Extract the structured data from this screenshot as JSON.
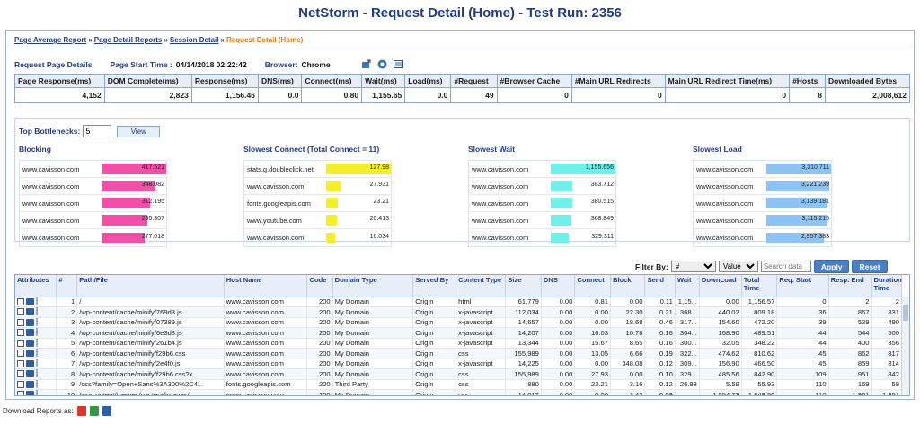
{
  "title": "NetStorm - Request Detail (Home) - Test Run: 2356",
  "breadcrumb": {
    "items": [
      "Page Average Report",
      "Page Detail Reports",
      "Session Detail"
    ],
    "current": "Request Detail (Home)",
    "separator": "»"
  },
  "info": {
    "section_label": "Request Page Details",
    "start_label": "Page Start Time :",
    "start_value": "04/14/2018 02:22:42",
    "browser_label": "Browser:",
    "browser_value": "Chrome"
  },
  "summary": {
    "headers": [
      "Page Response(ms)",
      "DOM Complete(ms)",
      "Response(ms)",
      "DNS(ms)",
      "Connect(ms)",
      "Wait(ms)",
      "Load(ms)",
      "#Request",
      "#Browser Cache",
      "#Main URL Redirects",
      "Main URL Redirect Time(ms)",
      "#Hosts",
      "Downloaded Bytes"
    ],
    "values": [
      "4,152",
      "2,823",
      "1,156.46",
      "0.0",
      "0.80",
      "1,155.65",
      "0.0",
      "49",
      "0",
      "0",
      "0",
      "8",
      "2,008,612"
    ]
  },
  "bottlenecks": {
    "label": "Top Bottlenecks:",
    "count": "5",
    "view_label": "View",
    "colors": {
      "blocking": "#f24fa8",
      "connect": "#f5ef2a",
      "wait": "#6ff0e8",
      "load": "#8ec3f5"
    },
    "blocking": {
      "title": "Blocking",
      "rows": [
        {
          "host": "www.cavisson.com",
          "value": "417.521",
          "fraction": 1.0
        },
        {
          "host": "www.cavisson.com",
          "value": "348.082",
          "fraction": 0.83
        },
        {
          "host": "www.cavisson.com",
          "value": "312.195",
          "fraction": 0.75
        },
        {
          "host": "www.cavisson.com",
          "value": "295.307",
          "fraction": 0.71
        },
        {
          "host": "www.cavisson.com",
          "value": "277.018",
          "fraction": 0.66
        }
      ]
    },
    "connect": {
      "title": "Slowest Connect (Total Connect = 11)",
      "rows": [
        {
          "host": "stats.g.doubleclick.net",
          "value": "127.98",
          "fraction": 1.0
        },
        {
          "host": "www.cavisson.com",
          "value": "27.931",
          "fraction": 0.22
        },
        {
          "host": "fonts.googleapis.com",
          "value": "23.21",
          "fraction": 0.18
        },
        {
          "host": "www.youtube.com",
          "value": "20.413",
          "fraction": 0.16
        },
        {
          "host": "www.cavisson.com",
          "value": "16.034",
          "fraction": 0.13
        }
      ]
    },
    "wait": {
      "title": "Slowest Wait",
      "rows": [
        {
          "host": "www.cavisson.com",
          "value": "1,155.656",
          "fraction": 1.0
        },
        {
          "host": "www.cavisson.com",
          "value": "383.712",
          "fraction": 0.33
        },
        {
          "host": "www.cavisson.com",
          "value": "380.515",
          "fraction": 0.33
        },
        {
          "host": "www.cavisson.com",
          "value": "368.849",
          "fraction": 0.32
        },
        {
          "host": "www.cavisson.com",
          "value": "329.311",
          "fraction": 0.28
        }
      ]
    },
    "load": {
      "title": "Slowest Load",
      "rows": [
        {
          "host": "www.cavisson.com",
          "value": "3,310.711",
          "fraction": 1.0
        },
        {
          "host": "www.cavisson.com",
          "value": "3,221.239",
          "fraction": 0.97
        },
        {
          "host": "www.cavisson.com",
          "value": "3,139.181",
          "fraction": 0.95
        },
        {
          "host": "www.cavisson.com",
          "value": "3,115.215",
          "fraction": 0.94
        },
        {
          "host": "www.cavisson.com",
          "value": "2,957.383",
          "fraction": 0.89
        }
      ]
    }
  },
  "filter": {
    "label": "Filter By:",
    "field_value": "#",
    "op_value": "Value",
    "search_placeholder": "Search data",
    "apply_label": "Apply",
    "reset_label": "Reset"
  },
  "grid": {
    "headers": [
      "Attributes",
      "#",
      "Path/File",
      "Host Name",
      "Code",
      "Domain Type",
      "Served By",
      "Content Type",
      "Size",
      "DNS",
      "Connect",
      "Block",
      "Send",
      "Wait",
      "DownLoad",
      "Total Time",
      "Req. Start",
      "Resp. End",
      "Duration Time"
    ],
    "rows": [
      [
        "1",
        "/",
        "www.cavisson.com",
        "200",
        "My Domain",
        "Origin",
        "html",
        "61,779",
        "0.00",
        "0.81",
        "0.00",
        "0.11",
        "1,15...",
        "0.00",
        "1,156.57",
        "0",
        "2",
        "2"
      ],
      [
        "2",
        "/wp-content/cache/minify/769d3.js",
        "www.cavisson.com",
        "200",
        "My Domain",
        "Origin",
        "x-javascript",
        "112,034",
        "0.00",
        "0.00",
        "22.30",
        "0.21",
        "368...",
        "440.02",
        "809.18",
        "36",
        "867",
        "831"
      ],
      [
        "3",
        "/wp-content/cache/minify/07389.js",
        "www.cavisson.com",
        "200",
        "My Domain",
        "Origin",
        "x-javascript",
        "14,657",
        "0.00",
        "0.00",
        "18.68",
        "0.46",
        "317...",
        "154.60",
        "472.20",
        "39",
        "529",
        "490"
      ],
      [
        "4",
        "/wp-content/cache/minify/6e3d8.js",
        "www.cavisson.com",
        "200",
        "My Domain",
        "Origin",
        "x-javascript",
        "14,207",
        "0.00",
        "16.03",
        "10.78",
        "0.16",
        "304...",
        "168.90",
        "489.51",
        "44",
        "544",
        "500"
      ],
      [
        "5",
        "/wp-content/cache/minify/261b4.js",
        "www.cavisson.com",
        "200",
        "My Domain",
        "Origin",
        "x-javascript",
        "13,344",
        "0.00",
        "15.67",
        "8.65",
        "0.16",
        "300...",
        "32.05",
        "348.22",
        "44",
        "400",
        "356"
      ],
      [
        "6",
        "/wp-content/cache/minify/f29b6.css",
        "www.cavisson.com",
        "200",
        "My Domain",
        "Origin",
        "css",
        "155,989",
        "0.00",
        "13.05",
        "6.66",
        "0.19",
        "322...",
        "474.62",
        "810.62",
        "45",
        "862",
        "817"
      ],
      [
        "7",
        "/wp-content/cache/minify/2e4f0.js",
        "www.cavisson.com",
        "200",
        "My Domain",
        "Origin",
        "x-javascript",
        "14,225",
        "0.00",
        "0.00",
        "348.08",
        "0.12",
        "309...",
        "156.90",
        "466.50",
        "45",
        "859",
        "814"
      ],
      [
        "8",
        "/wp-content/cache/minify/f29b6.css?x...",
        "www.cavisson.com",
        "200",
        "My Domain",
        "Origin",
        "css",
        "155,989",
        "0.00",
        "27.93",
        "0.00",
        "0.10",
        "329...",
        "485.56",
        "842.90",
        "109",
        "951",
        "842"
      ],
      [
        "9",
        "/css?family=Open+Sans%3A300%2C4...",
        "fonts.googleapis.com",
        "200",
        "Third Party",
        "Origin",
        "css",
        "880",
        "0.00",
        "23.21",
        "3.16",
        "0.12",
        "26.98",
        "5.59",
        "55.93",
        "110",
        "169",
        "59"
      ],
      [
        "10",
        "/wp-content/themes/pactera/images/l...",
        "www.cavisson.com",
        "200",
        "My Domain",
        "Origin",
        "css",
        "14,017",
        "0.00",
        "0.00",
        "3.43",
        "0.09",
        "...",
        "1,554.73",
        "1,848.50",
        "110",
        "1,961",
        "1,851"
      ]
    ]
  },
  "download": {
    "label": "Download Reports as:"
  }
}
